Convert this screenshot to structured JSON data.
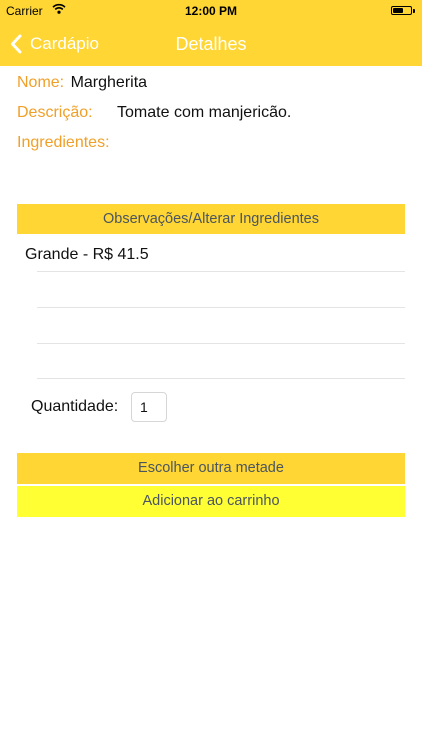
{
  "status_bar": {
    "carrier": "Carrier",
    "time": "12:00 PM",
    "wifi_icon": "wifi-icon",
    "battery_icon": "battery-icon"
  },
  "nav": {
    "back_label": "Cardápio",
    "back_icon": "chevron-left-icon",
    "title": "Detalhes"
  },
  "details": {
    "name_label": "Nome:",
    "name_value": "Margherita",
    "description_label": "Descrição:",
    "description_value": "Tomate com manjericão.",
    "ingredients_label": "Ingredientes:"
  },
  "observations_label": "Observações/Alterar Ingredientes",
  "options": [
    "Grande - R$ 41.5"
  ],
  "quantity": {
    "label": "Quantidade:",
    "value": "1"
  },
  "buttons": {
    "choose_half": "Escolher outra metade",
    "add_to_cart": "Adicionar ao carrinho"
  },
  "colors": {
    "header": "#FFD633",
    "label_orange": "#F0A028",
    "cart_button": "#FFFF33",
    "button_text": "#4A5560"
  }
}
